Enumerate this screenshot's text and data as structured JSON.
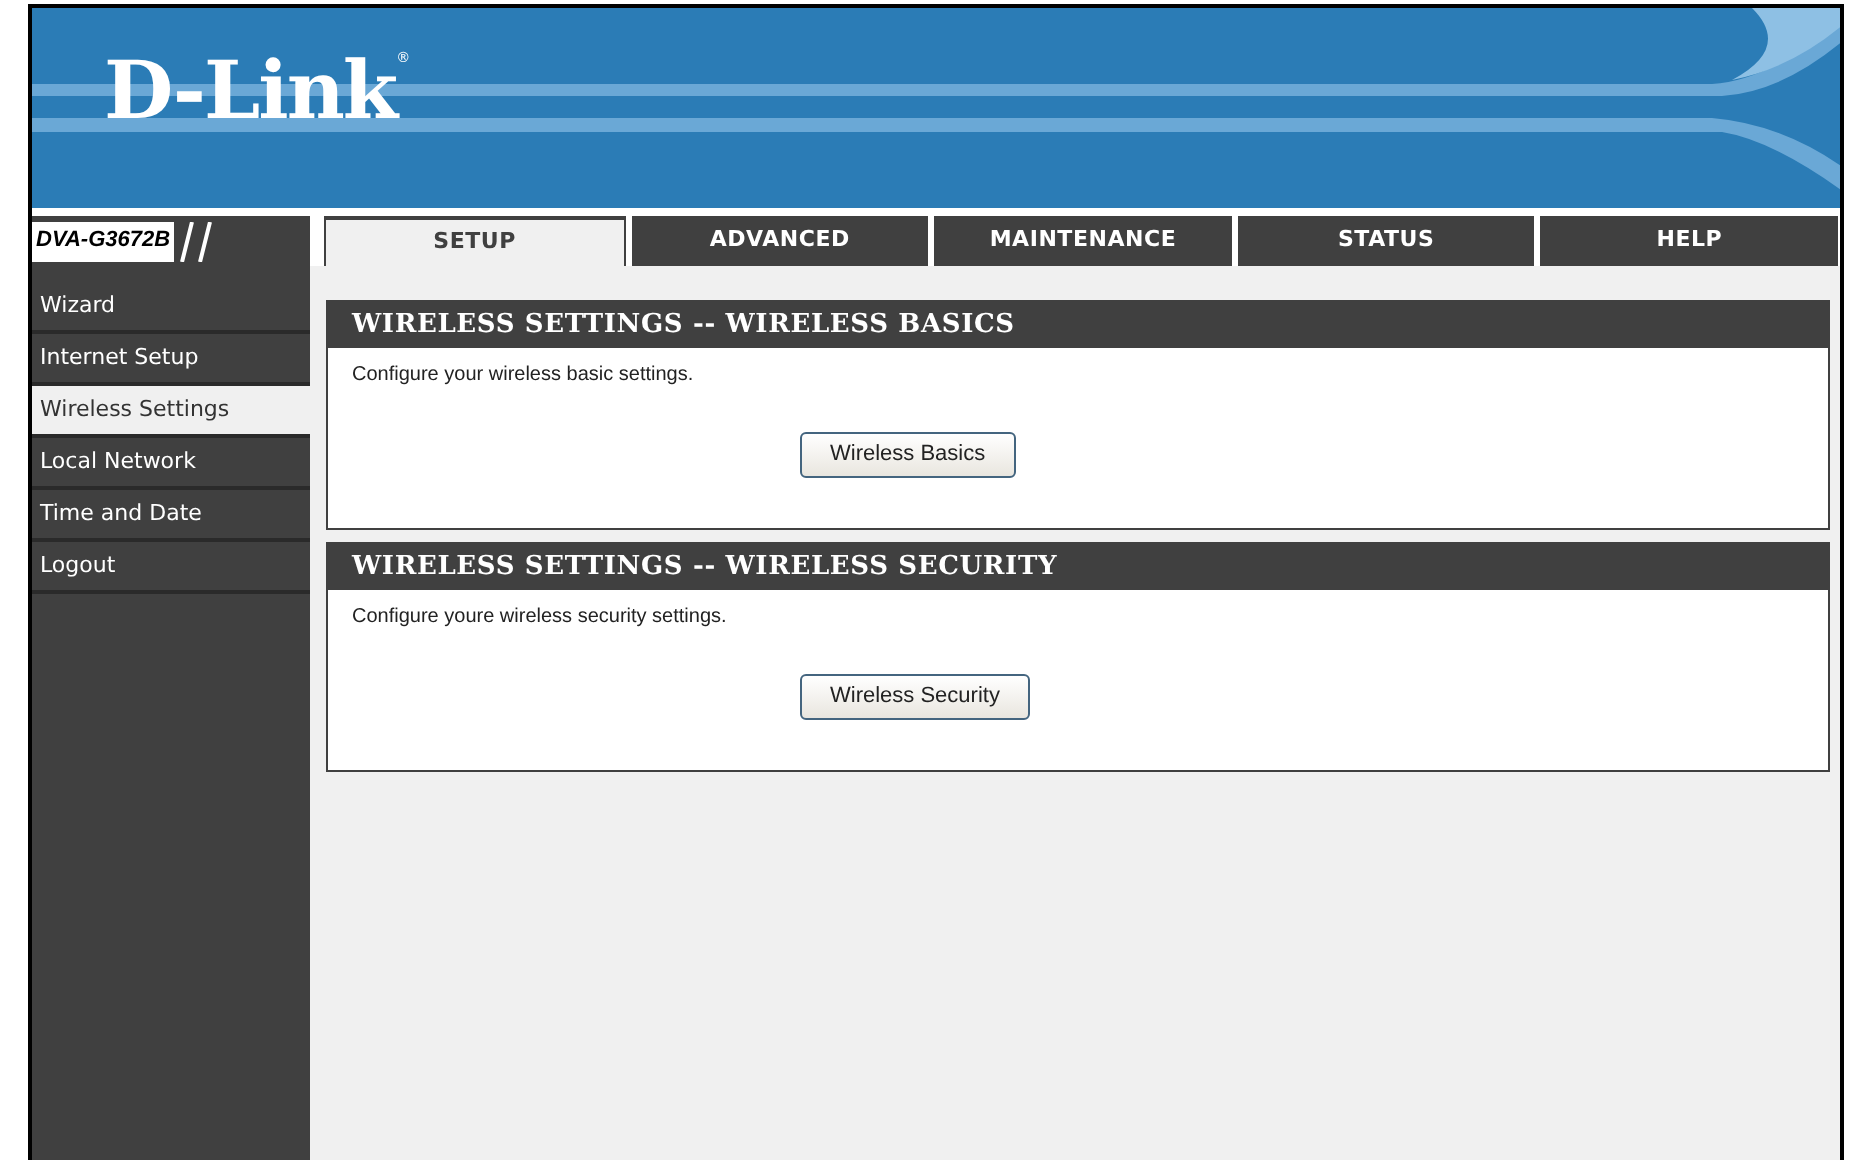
{
  "header": {
    "logo": "D-Link",
    "registered_mark": "®"
  },
  "model": "DVA-G3672B",
  "tabs": [
    {
      "label": "SETUP",
      "selected": true
    },
    {
      "label": "ADVANCED",
      "selected": false
    },
    {
      "label": "MAINTENANCE",
      "selected": false
    },
    {
      "label": "STATUS",
      "selected": false
    },
    {
      "label": "HELP",
      "selected": false
    }
  ],
  "sidebar": {
    "items": [
      {
        "label": "Wizard",
        "selected": false
      },
      {
        "label": "Internet Setup",
        "selected": false
      },
      {
        "label": "Wireless Settings",
        "selected": true
      },
      {
        "label": "Local Network",
        "selected": false
      },
      {
        "label": "Time and Date",
        "selected": false
      },
      {
        "label": "Logout",
        "selected": false
      }
    ]
  },
  "sections": [
    {
      "title": "WIRELESS SETTINGS -- WIRELESS BASICS",
      "description": "Configure your wireless basic settings.",
      "button": "Wireless Basics"
    },
    {
      "title": "WIRELESS SETTINGS -- WIRELESS SECURITY",
      "description": "Configure youre wireless security settings.",
      "button": "Wireless Security"
    }
  ]
}
